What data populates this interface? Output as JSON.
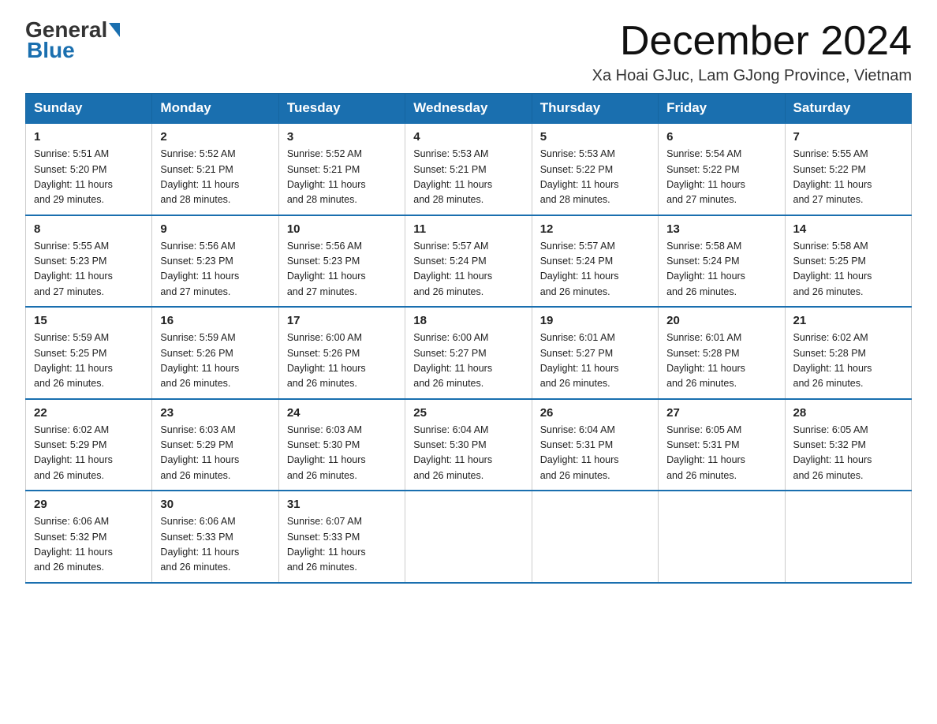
{
  "logo": {
    "general": "General",
    "blue": "Blue"
  },
  "header": {
    "month_year": "December 2024",
    "location": "Xa Hoai GJuc, Lam GJong Province, Vietnam"
  },
  "days_of_week": [
    "Sunday",
    "Monday",
    "Tuesday",
    "Wednesday",
    "Thursday",
    "Friday",
    "Saturday"
  ],
  "weeks": [
    [
      {
        "day": "1",
        "sunrise": "5:51 AM",
        "sunset": "5:20 PM",
        "daylight": "11 hours and 29 minutes."
      },
      {
        "day": "2",
        "sunrise": "5:52 AM",
        "sunset": "5:21 PM",
        "daylight": "11 hours and 28 minutes."
      },
      {
        "day": "3",
        "sunrise": "5:52 AM",
        "sunset": "5:21 PM",
        "daylight": "11 hours and 28 minutes."
      },
      {
        "day": "4",
        "sunrise": "5:53 AM",
        "sunset": "5:21 PM",
        "daylight": "11 hours and 28 minutes."
      },
      {
        "day": "5",
        "sunrise": "5:53 AM",
        "sunset": "5:22 PM",
        "daylight": "11 hours and 28 minutes."
      },
      {
        "day": "6",
        "sunrise": "5:54 AM",
        "sunset": "5:22 PM",
        "daylight": "11 hours and 27 minutes."
      },
      {
        "day": "7",
        "sunrise": "5:55 AM",
        "sunset": "5:22 PM",
        "daylight": "11 hours and 27 minutes."
      }
    ],
    [
      {
        "day": "8",
        "sunrise": "5:55 AM",
        "sunset": "5:23 PM",
        "daylight": "11 hours and 27 minutes."
      },
      {
        "day": "9",
        "sunrise": "5:56 AM",
        "sunset": "5:23 PM",
        "daylight": "11 hours and 27 minutes."
      },
      {
        "day": "10",
        "sunrise": "5:56 AM",
        "sunset": "5:23 PM",
        "daylight": "11 hours and 27 minutes."
      },
      {
        "day": "11",
        "sunrise": "5:57 AM",
        "sunset": "5:24 PM",
        "daylight": "11 hours and 26 minutes."
      },
      {
        "day": "12",
        "sunrise": "5:57 AM",
        "sunset": "5:24 PM",
        "daylight": "11 hours and 26 minutes."
      },
      {
        "day": "13",
        "sunrise": "5:58 AM",
        "sunset": "5:24 PM",
        "daylight": "11 hours and 26 minutes."
      },
      {
        "day": "14",
        "sunrise": "5:58 AM",
        "sunset": "5:25 PM",
        "daylight": "11 hours and 26 minutes."
      }
    ],
    [
      {
        "day": "15",
        "sunrise": "5:59 AM",
        "sunset": "5:25 PM",
        "daylight": "11 hours and 26 minutes."
      },
      {
        "day": "16",
        "sunrise": "5:59 AM",
        "sunset": "5:26 PM",
        "daylight": "11 hours and 26 minutes."
      },
      {
        "day": "17",
        "sunrise": "6:00 AM",
        "sunset": "5:26 PM",
        "daylight": "11 hours and 26 minutes."
      },
      {
        "day": "18",
        "sunrise": "6:00 AM",
        "sunset": "5:27 PM",
        "daylight": "11 hours and 26 minutes."
      },
      {
        "day": "19",
        "sunrise": "6:01 AM",
        "sunset": "5:27 PM",
        "daylight": "11 hours and 26 minutes."
      },
      {
        "day": "20",
        "sunrise": "6:01 AM",
        "sunset": "5:28 PM",
        "daylight": "11 hours and 26 minutes."
      },
      {
        "day": "21",
        "sunrise": "6:02 AM",
        "sunset": "5:28 PM",
        "daylight": "11 hours and 26 minutes."
      }
    ],
    [
      {
        "day": "22",
        "sunrise": "6:02 AM",
        "sunset": "5:29 PM",
        "daylight": "11 hours and 26 minutes."
      },
      {
        "day": "23",
        "sunrise": "6:03 AM",
        "sunset": "5:29 PM",
        "daylight": "11 hours and 26 minutes."
      },
      {
        "day": "24",
        "sunrise": "6:03 AM",
        "sunset": "5:30 PM",
        "daylight": "11 hours and 26 minutes."
      },
      {
        "day": "25",
        "sunrise": "6:04 AM",
        "sunset": "5:30 PM",
        "daylight": "11 hours and 26 minutes."
      },
      {
        "day": "26",
        "sunrise": "6:04 AM",
        "sunset": "5:31 PM",
        "daylight": "11 hours and 26 minutes."
      },
      {
        "day": "27",
        "sunrise": "6:05 AM",
        "sunset": "5:31 PM",
        "daylight": "11 hours and 26 minutes."
      },
      {
        "day": "28",
        "sunrise": "6:05 AM",
        "sunset": "5:32 PM",
        "daylight": "11 hours and 26 minutes."
      }
    ],
    [
      {
        "day": "29",
        "sunrise": "6:06 AM",
        "sunset": "5:32 PM",
        "daylight": "11 hours and 26 minutes."
      },
      {
        "day": "30",
        "sunrise": "6:06 AM",
        "sunset": "5:33 PM",
        "daylight": "11 hours and 26 minutes."
      },
      {
        "day": "31",
        "sunrise": "6:07 AM",
        "sunset": "5:33 PM",
        "daylight": "11 hours and 26 minutes."
      },
      null,
      null,
      null,
      null
    ]
  ],
  "labels": {
    "sunrise": "Sunrise:",
    "sunset": "Sunset:",
    "daylight": "Daylight:"
  }
}
